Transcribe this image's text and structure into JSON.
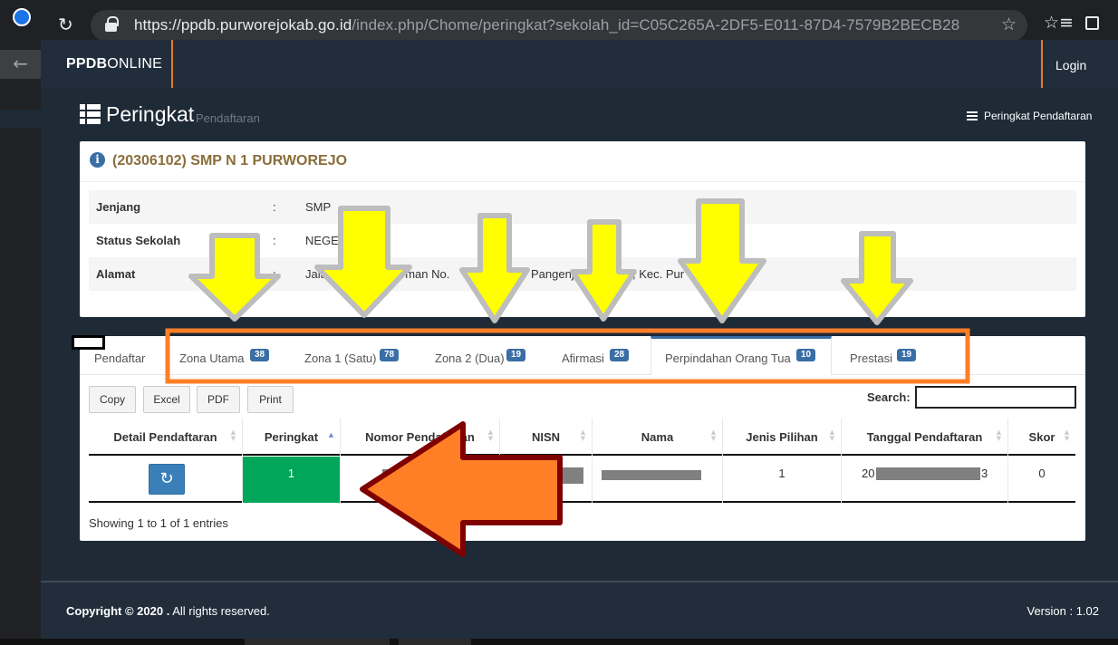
{
  "browser": {
    "url_host": "https://ppdb.purworejokab.go.id",
    "url_path": "/index.php/Chome/peringkat?sekolah_id=C05C265A-2DF5-E011-87D4-7579B2BECB28"
  },
  "nav": {
    "brand_bold": "PPDB",
    "brand_rest": "ONLINE",
    "login": "Login"
  },
  "page": {
    "title": "Peringkat",
    "subtitle": "Pendaftaran",
    "breadcrumb": "Peringkat Pendaftaran"
  },
  "school": {
    "title": "(20306102) SMP N 1 PURWOREJO",
    "rows": [
      {
        "label": "Jenjang",
        "colon": ":",
        "value": "SMP"
      },
      {
        "label": "Status Sekolah",
        "colon": ":",
        "value": "NEGE"
      },
      {
        "label": "Alamat",
        "colon": ":",
        "value": "Jala"
      }
    ],
    "address_frag1": "irman No.",
    "address_frag2": "Pangenj",
    "address_frag3": ", Kec. Pur"
  },
  "tabs": [
    {
      "label": "Pendaftar",
      "badge": ""
    },
    {
      "label": "Zona Utama",
      "badge": "38"
    },
    {
      "label": "Zona 1 (Satu)",
      "badge": "78"
    },
    {
      "label": "Zona 2 (Dua)",
      "badge": "19"
    },
    {
      "label": "Afirmasi",
      "badge": "28"
    },
    {
      "label": "Perpindahan Orang Tua",
      "badge": "10"
    },
    {
      "label": "Prestasi",
      "badge": "19"
    }
  ],
  "toolbar": {
    "copy": "Copy",
    "excel": "Excel",
    "pdf": "PDF",
    "print": "Print",
    "search_label": "Search:",
    "search_value": ""
  },
  "table": {
    "headers": [
      "Detail Pendaftaran",
      "Peringkat",
      "Nomor Pendaftaran",
      "NISN",
      "Nama",
      "Jenis Pilihan",
      "Tanggal Pendaftaran",
      "Skor"
    ],
    "row": {
      "peringkat": "1",
      "nomor_visible": "",
      "jenis_pilihan": "1",
      "tanggal_prefix": "20",
      "tanggal_suffix": "3",
      "skor": "0"
    },
    "info": "Showing 1 to 1 of 1 entries"
  },
  "footer": {
    "copyright_bold": "Copyright © 2020 .",
    "copyright_rest": " All rights reserved.",
    "version": "Version : 1.02"
  },
  "colors": {
    "accent": "#3a6ea5",
    "highlight_box": "#ff7f27",
    "arrow_yellow": "#ffff00",
    "arrow_orange": "#ff7f27",
    "arrow_outline": "#7f0000",
    "rank_green": "#00a65a"
  },
  "icons": [
    "reload-icon",
    "lock-icon",
    "star-icon",
    "favorites-icon",
    "collections-icon",
    "list-icon",
    "info-icon",
    "refresh-icon",
    "sort-icon"
  ]
}
